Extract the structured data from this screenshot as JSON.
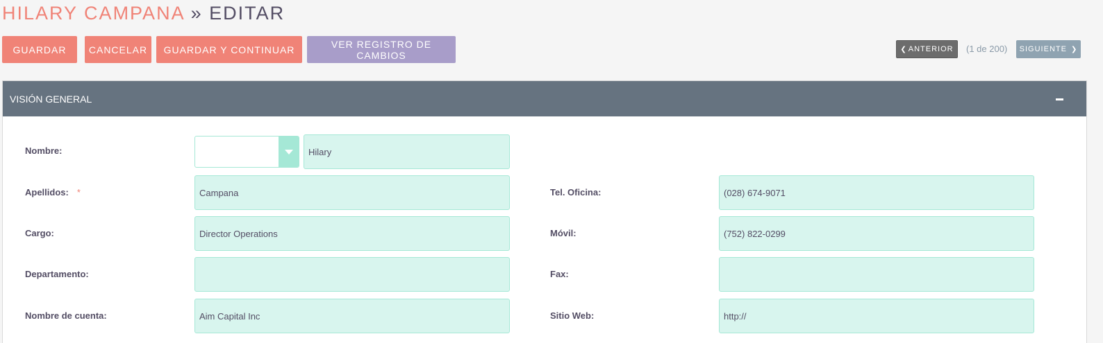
{
  "header": {
    "record_name": "HILARY CAMPANA",
    "separator": "»",
    "action": "EDITAR"
  },
  "toolbar": {
    "save_label": "GUARDAR",
    "cancel_label": "CANCELAR",
    "save_continue_label": "GUARDAR Y CONTINUAR",
    "view_changelog_label": "VER REGISTRO DE CAMBIOS"
  },
  "pagination": {
    "prev_label": "ANTERIOR",
    "count": "(1 de 200)",
    "next_label": "SIGUIENTE"
  },
  "panel": {
    "title": "VISIÓN GENERAL"
  },
  "fields": {
    "salutation": {
      "value": ""
    },
    "first_name": {
      "label": "Nombre:",
      "value": "Hilary"
    },
    "last_name": {
      "label": "Apellidos:",
      "required_marker": "*",
      "value": "Campana"
    },
    "title": {
      "label": "Cargo:",
      "value": "Director Operations"
    },
    "department": {
      "label": "Departamento:",
      "value": ""
    },
    "account_name": {
      "label": "Nombre de cuenta:",
      "value": "Aim Capital Inc"
    },
    "phone_work": {
      "label": "Tel. Oficina:",
      "value": "(028) 674-9071"
    },
    "phone_mobile": {
      "label": "Móvil:",
      "value": "(752) 822-0299"
    },
    "phone_fax": {
      "label": "Fax:",
      "value": ""
    },
    "website": {
      "label": "Sitio Web:",
      "value": "http://"
    }
  },
  "colors": {
    "primary": "#f08377",
    "secondary": "#a89dc9",
    "panel_header": "#667380",
    "field_bg": "#d8f5ee",
    "field_border": "#a5e8d6"
  },
  "icons": {
    "prev": "chevron-left-icon",
    "next": "chevron-right-icon",
    "collapse": "minus-icon",
    "dropdown": "triangle-down-icon"
  }
}
